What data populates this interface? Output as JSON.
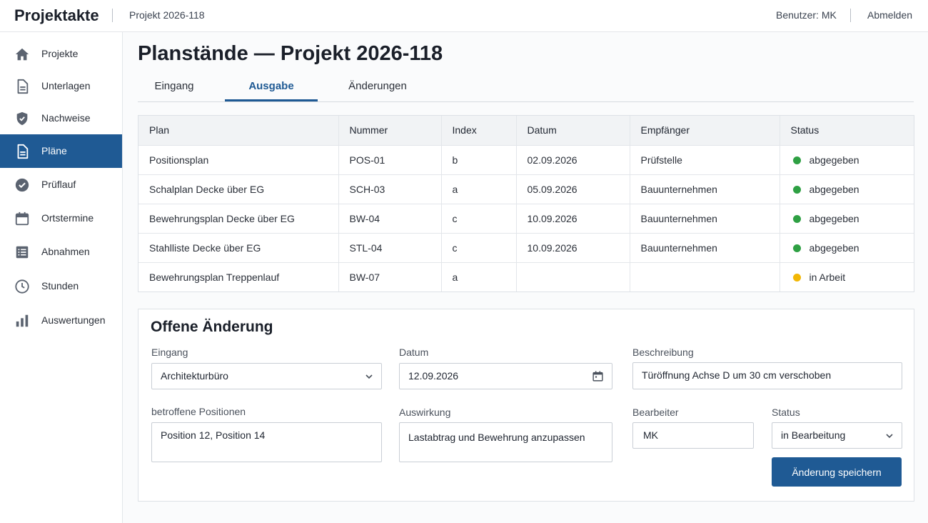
{
  "app": {
    "title": "Projektakte",
    "project": "Projekt 2026-118",
    "user": "Benutzer: MK",
    "logout": "Abmelden"
  },
  "sidebar": {
    "items": [
      {
        "label": "Projekte",
        "icon": "home-icon",
        "active": false
      },
      {
        "label": "Unterlagen",
        "icon": "document-icon",
        "active": false
      },
      {
        "label": "Nachweise",
        "icon": "shield-icon",
        "active": false
      },
      {
        "label": "Pläne",
        "icon": "document-icon",
        "active": true
      },
      {
        "label": "Prüflauf",
        "icon": "check-circle-icon",
        "active": false
      },
      {
        "label": "Ortstermine",
        "icon": "calendar-icon",
        "active": false
      },
      {
        "label": "Abnahmen",
        "icon": "checklist-icon",
        "active": false
      },
      {
        "label": "Stunden",
        "icon": "clock-icon",
        "active": false
      },
      {
        "label": "Auswertungen",
        "icon": "bar-chart-icon",
        "active": false
      }
    ]
  },
  "main": {
    "title": "Planstände — Projekt 2026-118",
    "tabs": [
      {
        "label": "Eingang",
        "active": false
      },
      {
        "label": "Ausgabe",
        "active": true
      },
      {
        "label": "Änderungen",
        "active": false
      }
    ]
  },
  "table": {
    "columns": [
      "Plan",
      "Nummer",
      "Index",
      "Datum",
      "Empfänger",
      "Status"
    ],
    "rows": [
      {
        "plan": "Positionsplan",
        "nummer": "POS-01",
        "index": "b",
        "datum": "02.09.2026",
        "empfaenger": "Prüfstelle",
        "status": "abgegeben",
        "status_color": "#2ea043"
      },
      {
        "plan": "Schalplan Decke über EG",
        "nummer": "SCH-03",
        "index": "a",
        "datum": "05.09.2026",
        "empfaenger": "Bauunternehmen",
        "status": "abgegeben",
        "status_color": "#2ea043"
      },
      {
        "plan": "Bewehrungsplan Decke über EG",
        "nummer": "BW-04",
        "index": "c",
        "datum": "10.09.2026",
        "empfaenger": "Bauunternehmen",
        "status": "abgegeben",
        "status_color": "#2ea043"
      },
      {
        "plan": "Stahlliste Decke über EG",
        "nummer": "STL-04",
        "index": "c",
        "datum": "10.09.2026",
        "empfaenger": "Bauunternehmen",
        "status": "abgegeben",
        "status_color": "#2ea043"
      },
      {
        "plan": "Bewehrungsplan Treppenlauf",
        "nummer": "BW-07",
        "index": "a",
        "datum": "",
        "empfaenger": "",
        "status": "in Arbeit",
        "status_color": "#f2b705"
      }
    ]
  },
  "form": {
    "title": "Offene Änderung",
    "eingang_label": "Eingang",
    "eingang_value": "Architekturbüro",
    "datum_label": "Datum",
    "datum_value": "12.09.2026",
    "beschreibung_label": "Beschreibung",
    "beschreibung_value": "Türöffnung Achse D um 30 cm verschoben",
    "positionen_label": "betroffene Positionen",
    "positionen_value": "Position 12, Position 14",
    "auswirkung_label": "Auswirkung",
    "auswirkung_value": "Lastabtrag und Bewehrung anzupassen",
    "bearbeiter_label": "Bearbeiter",
    "bearbeiter_value": "MK",
    "status_label": "Status",
    "status_value": "in Bearbeitung",
    "save_label": "Änderung speichern"
  },
  "colors": {
    "accent": "#1f5a94",
    "status_done": "#2ea043",
    "status_progress": "#f2b705"
  }
}
